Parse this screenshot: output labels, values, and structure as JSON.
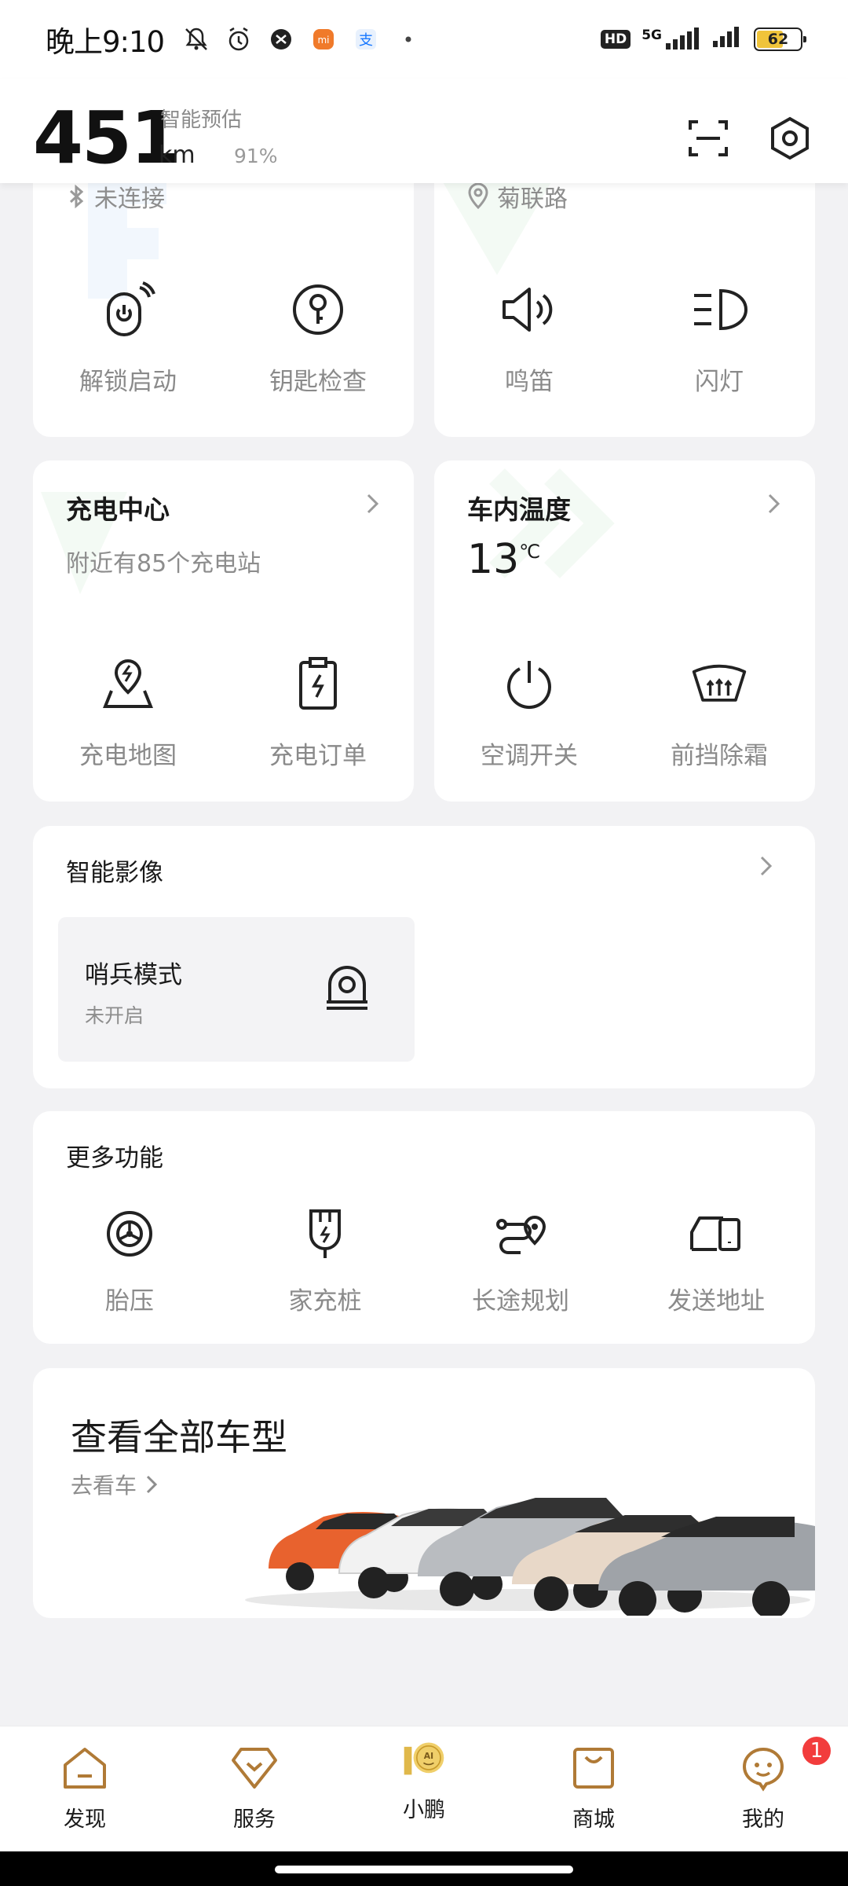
{
  "status_bar": {
    "time": "晚上9:10",
    "network": "5G",
    "hd": "HD",
    "battery": "62",
    "battery_level": 0.62
  },
  "header": {
    "range_value": "451",
    "range_unit": "km",
    "range_label": "智能预估",
    "battery_percent": "91%",
    "icons": [
      "scan-icon",
      "settings-icon"
    ]
  },
  "vehicle_card": {
    "bluetooth_status": "未连接",
    "actions": [
      {
        "label": "解锁启动",
        "icon": "unlock-start-icon"
      },
      {
        "label": "钥匙检查",
        "icon": "key-check-icon"
      }
    ]
  },
  "location_card": {
    "address": "菊联路",
    "actions": [
      {
        "label": "鸣笛",
        "icon": "horn-icon"
      },
      {
        "label": "闪灯",
        "icon": "flash-light-icon"
      }
    ]
  },
  "charging_card": {
    "title": "充电中心",
    "subtitle": "附近有85个充电站",
    "actions": [
      {
        "label": "充电地图",
        "icon": "charging-map-icon"
      },
      {
        "label": "充电订单",
        "icon": "charging-order-icon"
      }
    ]
  },
  "climate_card": {
    "title": "车内温度",
    "temperature": "13",
    "unit": "℃",
    "actions": [
      {
        "label": "空调开关",
        "icon": "ac-power-icon"
      },
      {
        "label": "前挡除霜",
        "icon": "defrost-icon"
      }
    ]
  },
  "imaging_card": {
    "title": "智能影像",
    "sentry": {
      "title": "哨兵模式",
      "status": "未开启",
      "icon": "camera-icon"
    }
  },
  "more_card": {
    "title": "更多功能",
    "items": [
      {
        "label": "胎压",
        "icon": "tire-pressure-icon"
      },
      {
        "label": "家充桩",
        "icon": "home-charger-icon"
      },
      {
        "label": "长途规划",
        "icon": "route-plan-icon"
      },
      {
        "label": "发送地址",
        "icon": "send-address-icon"
      }
    ]
  },
  "promo_card": {
    "title": "查看全部车型",
    "link": "去看车"
  },
  "tabbar": {
    "tabs": [
      {
        "label": "发现",
        "icon": "home-icon"
      },
      {
        "label": "服务",
        "icon": "service-icon"
      },
      {
        "label": "小鹏",
        "icon": "ai-logo-icon",
        "active": true
      },
      {
        "label": "商城",
        "icon": "shop-icon"
      },
      {
        "label": "我的",
        "icon": "profile-icon",
        "badge": "1"
      }
    ]
  },
  "colors": {
    "accent_gold": "#b07a36",
    "badge_red": "#f23c3c",
    "ai_gold": "#e0b84a"
  }
}
